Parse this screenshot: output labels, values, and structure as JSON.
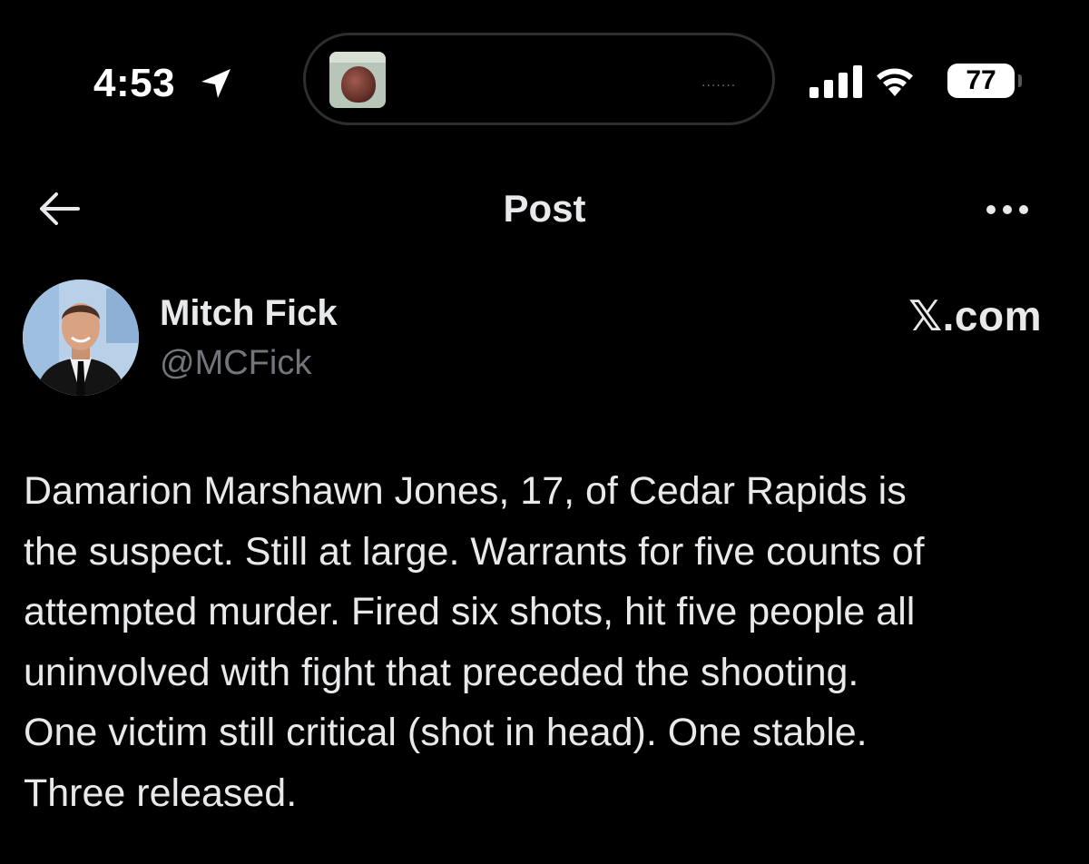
{
  "status_bar": {
    "time": "4:53",
    "battery_level": "77",
    "icons": [
      "location-arrow-icon",
      "cellular-signal-icon",
      "wifi-icon",
      "battery-icon"
    ],
    "dynamic_island_more": "......."
  },
  "header": {
    "title": "Post",
    "back_icon": "back-arrow-icon",
    "more_icon": "more-options-icon"
  },
  "post": {
    "author_name": "Mitch Fick",
    "author_handle": "@MCFick",
    "brand": "𝕏.com",
    "text": "Damarion Marshawn Jones, 17, of Cedar Rapids is\nthe suspect. Still at large. Warrants for five counts of\nattempted murder. Fired six shots, hit five people all\nuninvolved with fight that preceded the shooting.\nOne victim still critical (shot in head). One stable.\nThree released."
  },
  "colors": {
    "background": "#000000",
    "primary_text": "#e7e9ea",
    "secondary_text": "#71767b"
  }
}
